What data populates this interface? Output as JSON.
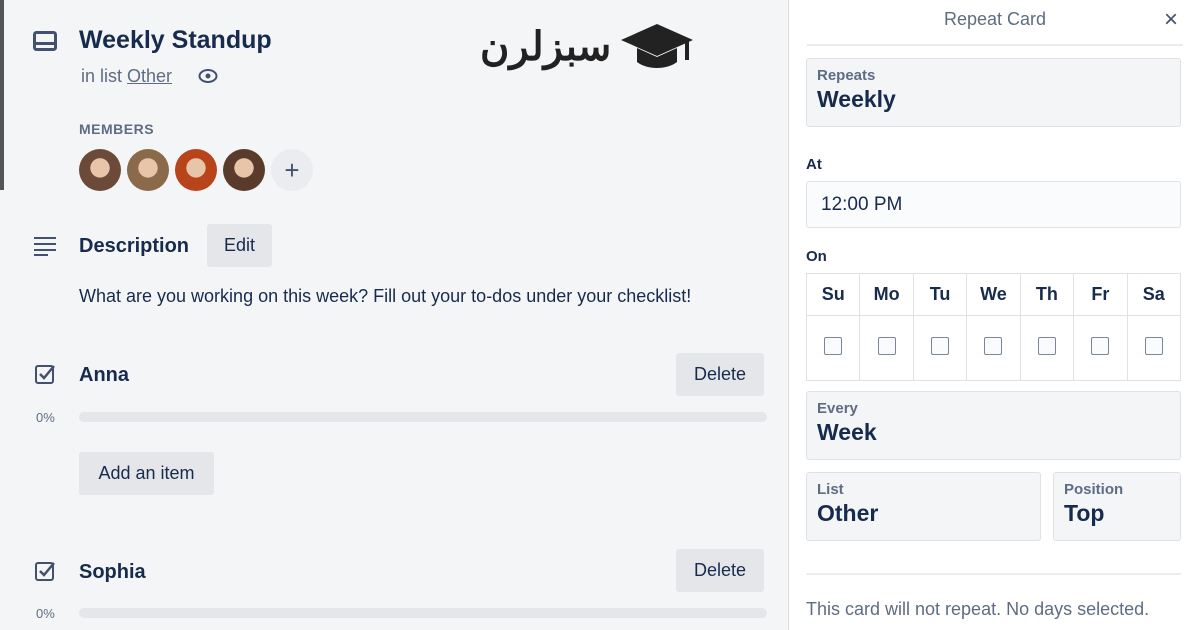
{
  "card": {
    "title": "Weekly Standup",
    "list_prefix": "in list",
    "list_name": "Other",
    "members_label": "MEMBERS",
    "members": [
      {
        "name": "member-1",
        "color": "#6b4a3a"
      },
      {
        "name": "member-2",
        "color": "#8a6a4a"
      },
      {
        "name": "member-3",
        "color": "#b8441c"
      },
      {
        "name": "member-4",
        "color": "#5a3a2a"
      }
    ],
    "add_member": "+",
    "description": {
      "heading": "Description",
      "edit_label": "Edit",
      "text": "What are you working on this week? Fill out your to-dos under your checklist!"
    },
    "checklists": [
      {
        "title": "Anna",
        "delete_label": "Delete",
        "percent": "0%",
        "progress": 0,
        "add_item_label": "Add an item"
      },
      {
        "title": "Sophia",
        "delete_label": "Delete",
        "percent": "0%",
        "progress": 0
      }
    ]
  },
  "watermark": {
    "text": "سبزلرن"
  },
  "repeat_panel": {
    "title": "Repeat Card",
    "close": "×",
    "repeats": {
      "label": "Repeats",
      "value": "Weekly"
    },
    "at": {
      "label": "At",
      "value": "12:00 PM"
    },
    "on": {
      "label": "On",
      "days": [
        "Su",
        "Mo",
        "Tu",
        "We",
        "Th",
        "Fr",
        "Sa"
      ],
      "checked": [
        false,
        false,
        false,
        false,
        false,
        false,
        false
      ]
    },
    "every": {
      "label": "Every",
      "value": "Week"
    },
    "list": {
      "label": "List",
      "value": "Other"
    },
    "position": {
      "label": "Position",
      "value": "Top"
    },
    "note": "This card will not repeat. No days selected."
  }
}
